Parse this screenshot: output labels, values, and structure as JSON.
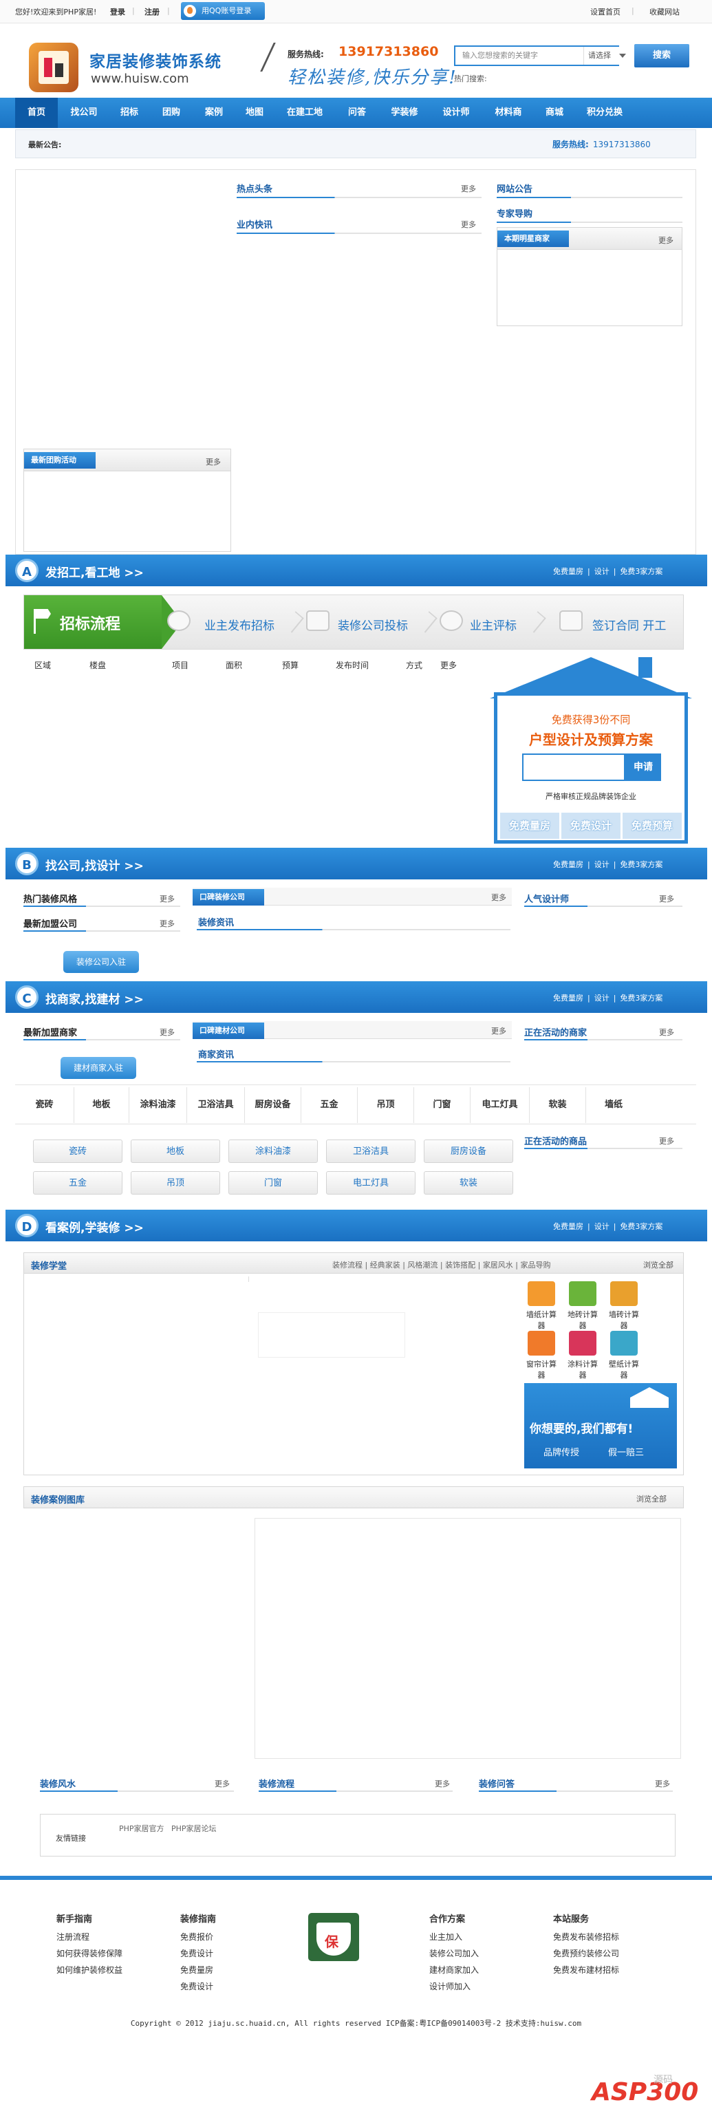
{
  "topbar": {
    "welcome": "您好!欢迎来到PHP家居!",
    "login": "登录",
    "register": "注册",
    "qq_login": "用QQ账号登录",
    "set_home": "设置首页",
    "favorite": "收藏网站"
  },
  "header": {
    "logo_title": "家居装修装饰系统",
    "logo_url": "www.huisw.com",
    "hotline_label": "服务热线:",
    "hotline_number": "13917313860",
    "slogan": "轻松装修,快乐分享!",
    "search_placeholder": "输入您想搜索的关键字",
    "search_select": "请选择",
    "search_button": "搜索",
    "hot_search": "热门搜索:"
  },
  "nav": [
    "首页",
    "找公司",
    "招标",
    "团购",
    "案例",
    "地图",
    "在建工地",
    "问答",
    "学装修",
    "设计师",
    "材料商",
    "商城",
    "积分兑换"
  ],
  "notice": {
    "label": "最新公告:",
    "hotline_label": "服务热线:",
    "hotline_number": "13917313860"
  },
  "top_section": {
    "hot_news": "热点头条",
    "industry_news": "业内快讯",
    "site_notice": "网站公告",
    "expert_guide": "专家导购",
    "star_merchant": "本期明星商家",
    "group_buy": "最新团购活动",
    "more": "更多"
  },
  "banners": [
    {
      "letter": "A",
      "title": "发招工,看工地 >>",
      "links": [
        "免费量房",
        "设计",
        "免费3家方案"
      ]
    },
    {
      "letter": "B",
      "title": "找公司,找设计 >>",
      "links": [
        "免费量房",
        "设计",
        "免费3家方案"
      ]
    },
    {
      "letter": "C",
      "title": "找商家,找建材 >>",
      "links": [
        "免费量房",
        "设计",
        "免费3家方案"
      ]
    },
    {
      "letter": "D",
      "title": "看案例,学装修 >>",
      "links": [
        "免费量房",
        "设计",
        "免费3家方案"
      ]
    }
  ],
  "flow": {
    "start": "招标流程",
    "steps": [
      "业主发布招标",
      "装修公司投标",
      "业主评标",
      "签订合同 开工"
    ]
  },
  "tender_columns": [
    "区域",
    "楼盘",
    "项目",
    "面积",
    "预算",
    "发布时间",
    "方式",
    "更多"
  ],
  "promo": {
    "line1": "免费获得3份不同",
    "line2": "户型设计及预算方案",
    "button": "申请",
    "note": "严格审核正规品牌装饰企业",
    "tabs": [
      "免费量房",
      "免费设计",
      "免费预算"
    ]
  },
  "company_section": {
    "hot_style": "热门装修风格",
    "new_company": "最新加盟公司",
    "praise_company": "口碑装修公司",
    "deco_info": "装修资讯",
    "popular_designer": "人气设计师",
    "join_button": "装修公司入驻",
    "more": "更多"
  },
  "merchant_section": {
    "new_merchant": "最新加盟商家",
    "praise_material": "口碑建材公司",
    "merchant_info": "商家资讯",
    "active_merchant": "正在活动的商家",
    "active_goods": "正在活动的商品",
    "join_button": "建材商家入驻",
    "more": "更多"
  },
  "categories": [
    "瓷砖",
    "地板",
    "涂料油漆",
    "卫浴洁具",
    "厨房设备",
    "五金",
    "吊顶",
    "门窗",
    "电工灯具",
    "软装",
    "墙纸"
  ],
  "category_buttons": [
    "瓷砖",
    "地板",
    "涂料油漆",
    "卫浴洁具",
    "厨房设备",
    "五金",
    "吊顶",
    "门窗",
    "电工灯具",
    "软装"
  ],
  "case_section": {
    "school": "装修学堂",
    "school_links": [
      "装修流程",
      "经典家装",
      "风格潮流",
      "装饰搭配",
      "家居风水",
      "家品导购"
    ],
    "browse_all": "浏览全部",
    "calculators": [
      {
        "label": "墙纸计算器",
        "color": "#f39a2e"
      },
      {
        "label": "地砖计算器",
        "color": "#6ab43a"
      },
      {
        "label": "墙砖计算器",
        "color": "#e9a02d"
      },
      {
        "label": "窗帘计算器",
        "color": "#f07a2a"
      },
      {
        "label": "涂料计算器",
        "color": "#d8355a"
      },
      {
        "label": "壁纸计算器",
        "color": "#3aa7c9"
      }
    ],
    "ad_line1": "你想要的,我们都有!",
    "ad_line2": "品牌传授",
    "ad_line3": "假一赔三",
    "gallery": "装修案例图库",
    "gallery_browse": "浏览全部",
    "fengshui": "装修风水",
    "process": "装修流程",
    "qa": "装修问答",
    "more": "更多",
    "friend_links": "友情链接",
    "friend_items": [
      "PHP家居官方",
      "PHP家居论坛"
    ]
  },
  "footer": {
    "cols": [
      {
        "title": "新手指南",
        "items": [
          "注册流程",
          "如何获得装修保障",
          "如何维护装修权益"
        ]
      },
      {
        "title": "装修指南",
        "items": [
          "免费报价",
          "免费设计",
          "免费量房",
          "免费设计"
        ]
      },
      {
        "title": "合作方案",
        "items": [
          "业主加入",
          "装修公司加入",
          "建材商家加入",
          "设计师加入"
        ]
      },
      {
        "title": "本站服务",
        "items": [
          "免费发布装修招标",
          "免费预约装修公司",
          "免费发布建材招标"
        ]
      }
    ],
    "shield_char": "保",
    "copyright": "Copyright © 2012 jiaju.sc.huaid.cn, All rights reserved  ICP备案:粤ICP备09014003号-2 技术支持:huisw.com",
    "watermark": "ASP300",
    "watermark_sub": "源码"
  },
  "colors": {
    "brand_blue": "#2a86d4",
    "orange": "#e95d0f",
    "nav_active": "#0d5aa6"
  }
}
